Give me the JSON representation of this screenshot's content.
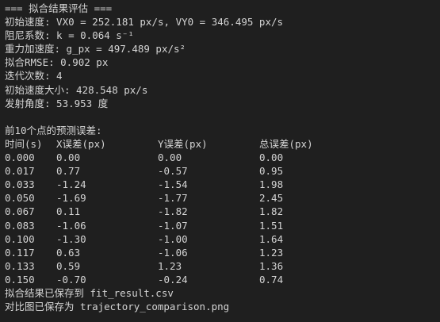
{
  "terminal": {
    "header": "=== 拟合结果评估 ===",
    "lines": [
      "初始速度: VX0 = 252.181 px/s, VY0 = 346.495 px/s",
      "阻尼系数: k = 0.064 s⁻¹",
      "重力加速度: g_px = 497.489 px/s²",
      "拟合RMSE: 0.902 px",
      "迭代次数: 4",
      "初始速度大小: 428.548 px/s",
      "发射角度: 53.953 度"
    ],
    "table_title": "前10个点的预测误差:",
    "table_headers": [
      "时间(s)",
      "X误差(px)",
      "Y误差(px)",
      "总误差(px)"
    ],
    "table_rows": [
      [
        "0.000",
        "0.00",
        "0.00",
        "0.00"
      ],
      [
        "0.017",
        "0.77",
        "-0.57",
        "0.95"
      ],
      [
        "0.033",
        "-1.24",
        "-1.54",
        "1.98"
      ],
      [
        "0.050",
        "-1.69",
        "-1.77",
        "2.45"
      ],
      [
        "0.067",
        "0.11",
        "-1.82",
        "1.82"
      ],
      [
        "0.083",
        "-1.06",
        "-1.07",
        "1.51"
      ],
      [
        "0.100",
        "-1.30",
        "-1.00",
        "1.64"
      ],
      [
        "0.117",
        "0.63",
        "-1.06",
        "1.23"
      ],
      [
        "0.133",
        "0.59",
        "1.23",
        "1.36"
      ],
      [
        "0.150",
        "-0.70",
        "-0.24",
        "0.74"
      ]
    ],
    "footer": [
      "拟合结果已保存到 fit_result.csv",
      "对比图已保存为 trajectory_comparison.png"
    ]
  }
}
